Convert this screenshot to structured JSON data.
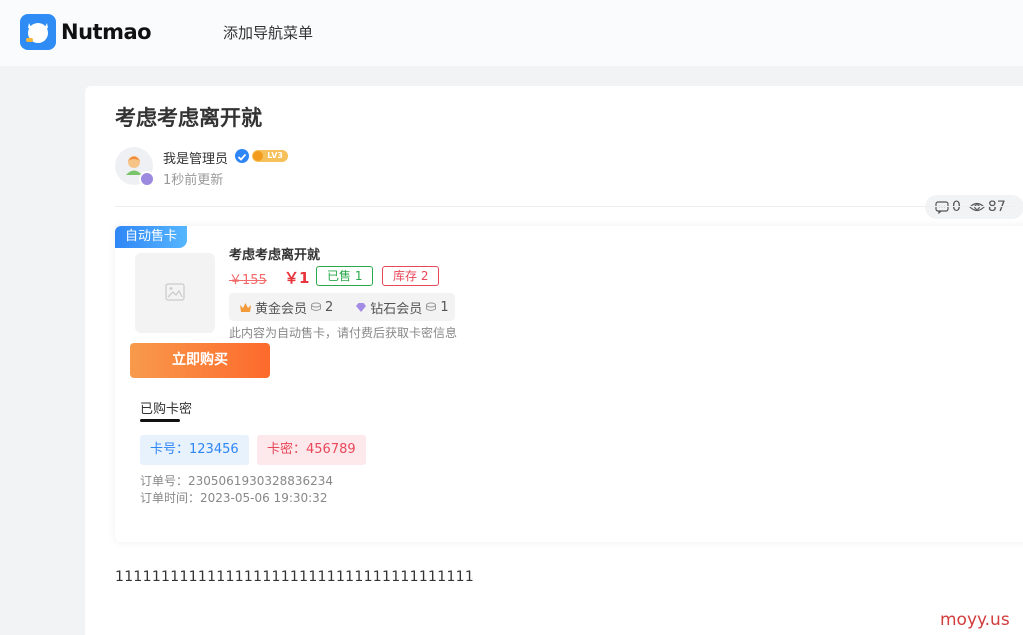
{
  "header": {
    "logo_text": "Nutmao",
    "nav_item": "添加导航菜单"
  },
  "post": {
    "title": "考虑考虑离开就",
    "author": "我是管理员",
    "level": "LV3",
    "updated": "1秒前更新",
    "comments": "0",
    "views": "87",
    "body": "111111111111111111111111111111111111111"
  },
  "product": {
    "tag": "自动售卡",
    "title": "考虑考虑离开就",
    "old_price": "￥155",
    "new_price": "￥1",
    "sold": "已售 1",
    "stock": "库存 2",
    "gold_member": "黄金会员",
    "gold_price": "2",
    "diamond_member": "钻石会员",
    "diamond_price": "1",
    "notice": "此内容为自动售卡，请付费后获取卡密信息",
    "buy_label": "立即购买",
    "purchased_tab": "已购卡密",
    "card_no": "卡号：123456",
    "card_pw": "卡密：456789",
    "order_no": "订单号：2305061930328836234",
    "order_time": "订单时间：2023-05-06 19:30:32"
  },
  "watermark": "moyy.us",
  "colors": {
    "accent": "#2f86f6",
    "buy": "#fd6a2c",
    "price": "#e8343a",
    "sold": "#2aa84a",
    "stock": "#e8485a"
  }
}
